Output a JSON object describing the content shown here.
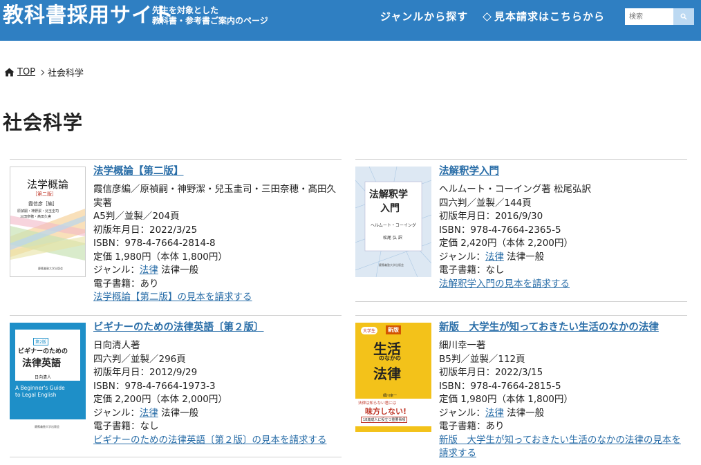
{
  "header": {
    "site_title": "教科書採用サイト",
    "subtitle_line1": "先生を対象とした",
    "subtitle_line2": "教科書・参考書ご案内のページ",
    "nav_genre": "ジャンルから探す",
    "nav_sample": "見本請求はこちらから",
    "search_placeholder": "検索"
  },
  "breadcrumb": {
    "home": "TOP",
    "current": "社会科学"
  },
  "page_title": "社会科学",
  "labels": {
    "genre_prefix": "ジャンル："
  },
  "books": [
    {
      "title": "法学概論【第二版】",
      "author": "霞信彦編／原禎嗣・神野潔・兒玉圭司・三田奈穂・髙田久実著",
      "format": "A5判／並製／204頁",
      "date": "初版年月日：2022/3/25",
      "isbn": "ISBN：978-4-7664-2814-8",
      "price": "定価 1,980円（本体 1,800円）",
      "genre_link": "法律",
      "genre_sub": "法律一般",
      "ebook": "電子書籍：あり",
      "request": "法学概論【第二版】の見本を請求する",
      "cover": {
        "title": "法学概論",
        "edition": "［第二版］",
        "editor": "霞信彦［編］",
        "authors1": "原禎嗣・神野潔・兒玉圭司",
        "authors2": "三田奈穂・髙田久実",
        "publisher": "慶應義塾大学出版会"
      }
    },
    {
      "title": "法解釈学入門",
      "author": "ヘルムート・コーイング著 松尾弘訳",
      "format": "四六判／並製／144頁",
      "date": "初版年月日：2016/9/30",
      "isbn": "ISBN：978-4-7664-2365-5",
      "price": "定価 2,420円（本体 2,200円）",
      "genre_link": "法律",
      "genre_sub": "法律一般",
      "ebook": "電子書籍：なし",
      "request": "法解釈学入門の見本を請求する",
      "cover": {
        "title1": "法解釈学",
        "title2": "入門",
        "author": "ヘルムート・コーイング",
        "translator": "松尾 弘 訳",
        "publisher": "慶應義塾大学出版会"
      }
    },
    {
      "title": "ビギナーのための法律英語〔第２版〕",
      "author": "日向清人著",
      "format": "四六判／並製／296頁",
      "date": "初版年月日：2012/9/29",
      "isbn": "ISBN：978-4-7664-1973-3",
      "price": "定価 2,200円（本体 2,000円）",
      "genre_link": "法律",
      "genre_sub": "法律一般",
      "ebook": "電子書籍：なし",
      "request": "ビギナーのための法律英語〔第２版〕の見本を請求する",
      "cover": {
        "edition": "第2版",
        "title1": "ビギナーのための",
        "title2": "法律英語",
        "author": "日向清人",
        "en1": "A Beginner's Guide",
        "en2": "to Legal English",
        "publisher": "慶應義塾大学出版会"
      }
    },
    {
      "title": "新版　大学生が知っておきたい生活のなかの法律",
      "author": "細川幸一著",
      "format": "B5判／並製／112頁",
      "date": "初版年月日：2022/3/15",
      "isbn": "ISBN：978-4-7664-2815-5",
      "price": "定価 1,980円（本体 1,800円）",
      "genre_link": "法律",
      "genre_sub": "法律一般",
      "ebook": "電子書籍：あり",
      "request": "新版　大学生が知っておきたい生活のなかの法律の見本を請求する",
      "cover": {
        "badge1": "大学生",
        "badge2": "新版",
        "title1": "生活",
        "title2": "のなかの",
        "title3": "法律",
        "author": "細川幸一",
        "banner1": "法律は知らない君には",
        "banner2": "味方しない!",
        "banner3": "18歳成人に役立つ重要事項"
      }
    }
  ]
}
